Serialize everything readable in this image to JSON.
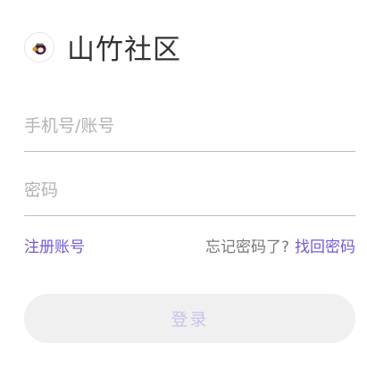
{
  "header": {
    "logo_icon": "mangosteen-icon",
    "title": "山竹社区"
  },
  "form": {
    "phone_placeholder": "手机号/账号",
    "phone_value": "",
    "password_placeholder": "密码",
    "password_value": ""
  },
  "links": {
    "register_label": "注册账号",
    "forgot_question": "忘记密码了?",
    "recover_label": "找回密码"
  },
  "login_button": {
    "label": "登录"
  },
  "colors": {
    "accent": "#6c5bd4",
    "button_bg": "#f0f0f0",
    "button_text_disabled": "#c9c2ea"
  }
}
